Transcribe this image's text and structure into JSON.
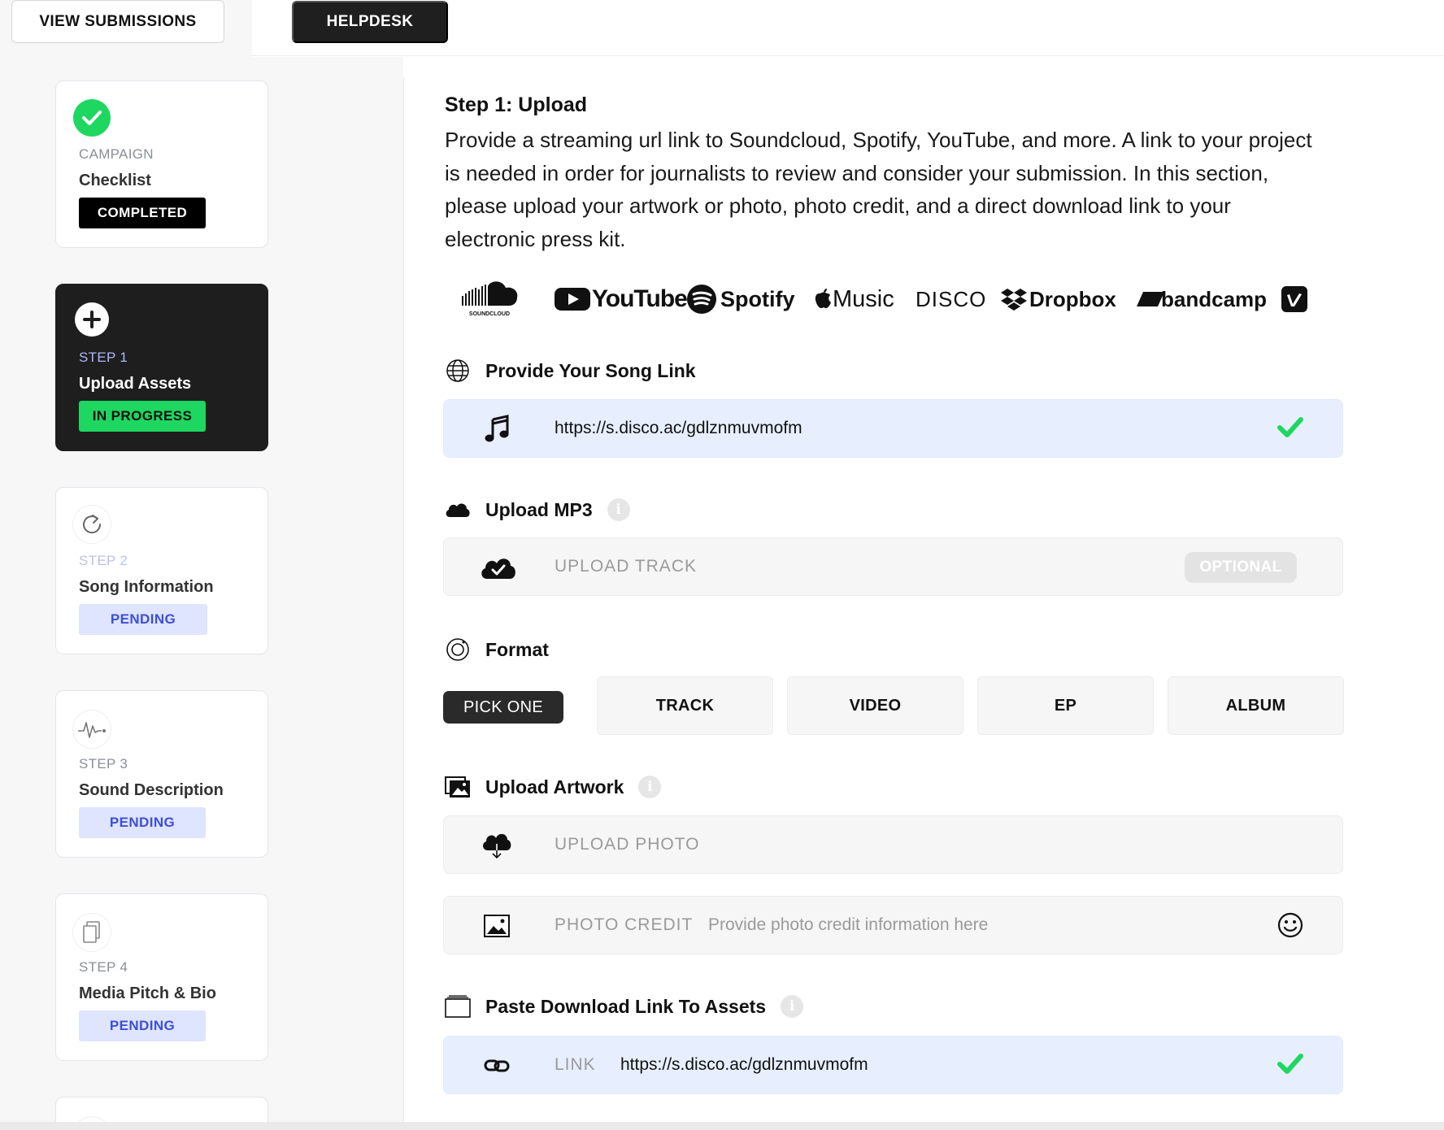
{
  "topbar": {
    "view_submissions": "VIEW SUBMISSIONS",
    "helpdesk": "HELPDESK"
  },
  "sidebar": {
    "cards": [
      {
        "eyebrow": "CAMPAIGN",
        "title": "Checklist",
        "badge": "COMPLETED",
        "icon": "check-circle-icon"
      },
      {
        "eyebrow": "STEP 1",
        "title": "Upload Assets",
        "badge": "IN PROGRESS",
        "icon": "plus-circle-icon"
      },
      {
        "eyebrow": "STEP 2",
        "title": "Song Information",
        "badge": "PENDING",
        "icon": "refresh-icon"
      },
      {
        "eyebrow": "STEP 3",
        "title": "Sound Description",
        "badge": "PENDING",
        "icon": "waveform-icon"
      },
      {
        "eyebrow": "STEP 4",
        "title": "Media Pitch & Bio",
        "badge": "PENDING",
        "icon": "document-icon"
      }
    ]
  },
  "main": {
    "step_title": "Step 1: Upload",
    "intro": "Provide a streaming url link to Soundcloud, Spotify, YouTube, and more. A link to your project is needed in order for journalists to review and consider your submission. In this section, please upload your artwork or photo, photo credit, and a direct download link to your electronic press kit.",
    "logos": [
      "SOUNDCLOUD",
      "YouTube",
      "Spotify",
      "Music",
      "DISCO",
      "Dropbox",
      "bandcamp",
      "vimeo"
    ],
    "song_link": {
      "title": "Provide Your Song Link",
      "value": "https://s.disco.ac/gdlznmuvmofm"
    },
    "mp3": {
      "title": "Upload MP3",
      "label": "UPLOAD TRACK",
      "optional": "OPTIONAL"
    },
    "format": {
      "title": "Format",
      "pick_one": "PICK ONE",
      "options": [
        "TRACK",
        "VIDEO",
        "EP",
        "ALBUM"
      ]
    },
    "artwork": {
      "title": "Upload Artwork",
      "upload_label": "UPLOAD PHOTO",
      "credit_label": "PHOTO CREDIT",
      "credit_placeholder": "Provide photo credit information here"
    },
    "download": {
      "title": "Paste Download Link To Assets",
      "label": "LINK",
      "value": "https://s.disco.ac/gdlznmuvmofm"
    }
  },
  "colors": {
    "green": "#1ed760",
    "dark": "#1e1e1e",
    "pending_bg": "#dfe4ff",
    "pending_text": "#3d4fd6",
    "blue_field": "#e7efff"
  }
}
